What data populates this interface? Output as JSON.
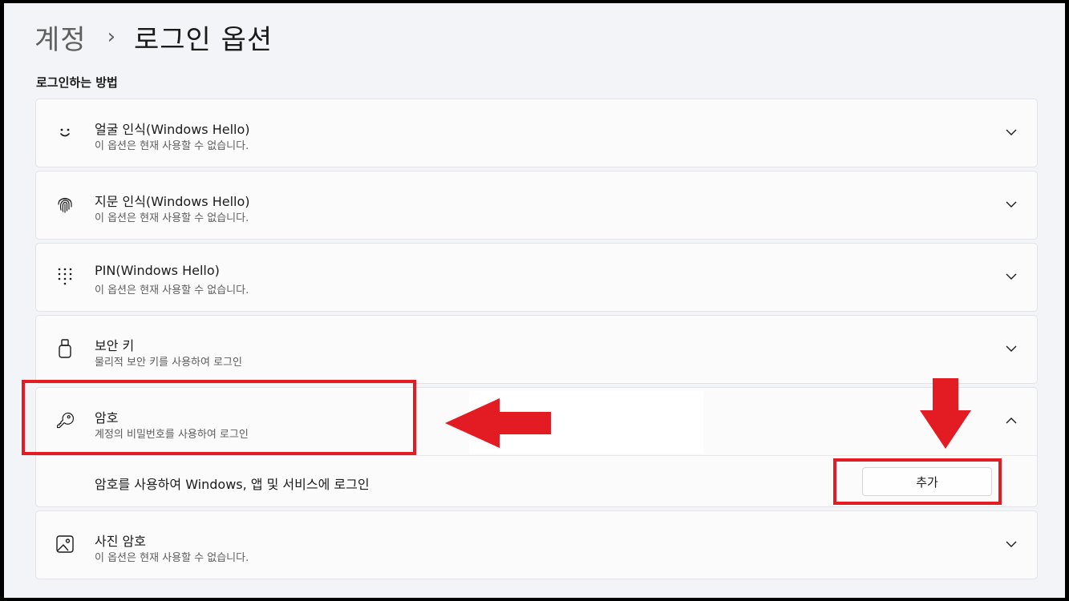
{
  "breadcrumb": {
    "parent": "계정",
    "separator": "›",
    "current": "로그인 옵션"
  },
  "section_label": "로그인하는 방법",
  "options": [
    {
      "icon": "face-icon",
      "title": "얼굴 인식(Windows Hello)",
      "desc": "이 옵션은 현재 사용할 수 없습니다."
    },
    {
      "icon": "fingerprint-icon",
      "title": "지문 인식(Windows Hello)",
      "desc": "이 옵션은 현재 사용할 수 없습니다."
    },
    {
      "icon": "pin-keypad-icon",
      "title": "PIN(Windows Hello)",
      "desc": "이 옵션은 현재 사용할 수 없습니다."
    },
    {
      "icon": "usb-key-icon",
      "title": "보안 키",
      "desc": "물리적 보안 키를 사용하여 로그인"
    },
    {
      "icon": "key-icon",
      "title": "암호",
      "desc": "계정의 비밀번호를 사용하여 로그인",
      "expanded": true
    },
    {
      "icon": "picture-icon",
      "title": "사진 암호",
      "desc": "이 옵션은 현재 사용할 수 없습니다."
    }
  ],
  "password_panel": {
    "text": "암호를 사용하여 Windows, 앱 및 서비스에 로그인",
    "add_button": "추가"
  },
  "colors": {
    "highlight": "#e31b23",
    "background": "#f3f4f7",
    "card": "#fbfbfc"
  }
}
